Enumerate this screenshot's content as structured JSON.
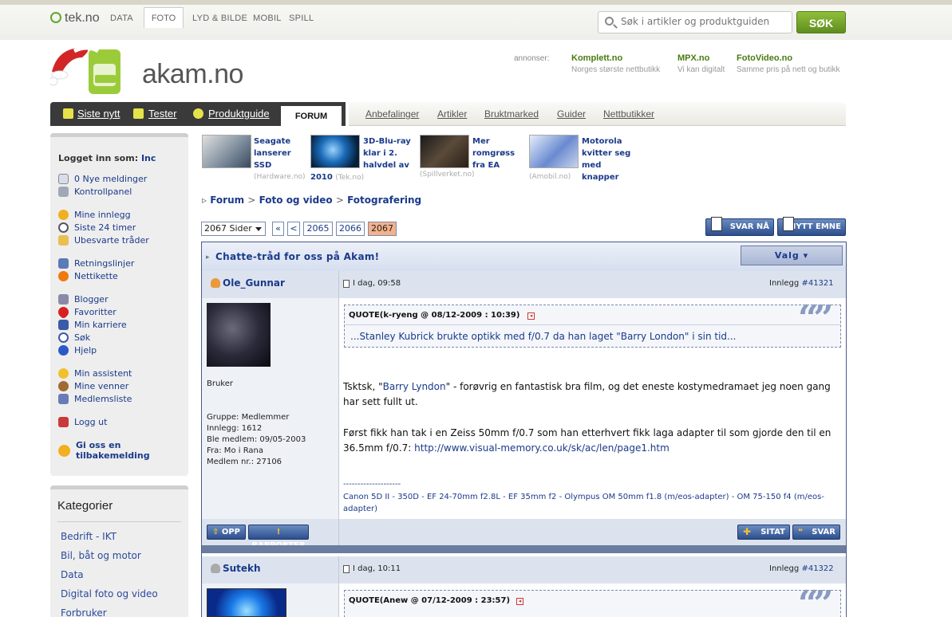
{
  "top": {
    "brand": "tek.no",
    "tabs": [
      "DATA",
      "FOTO",
      "LYD & BILDE",
      "MOBIL",
      "SPILL"
    ],
    "search_placeholder": "Søk i artikler og produktguiden",
    "search_button": "SØK"
  },
  "logo": {
    "text": "akam.no"
  },
  "ads": {
    "label": "annonser:",
    "items": [
      {
        "title": "Komplett.no",
        "sub": "Norges største nettbutikk"
      },
      {
        "title": "MPX.no",
        "sub": "Vi kan digitalt"
      },
      {
        "title": "FotoVideo.no",
        "sub": "Samme pris på nett og butikk"
      }
    ]
  },
  "nav": {
    "dark": [
      "Siste nytt",
      "Tester",
      "Produktguide"
    ],
    "active": "FORUM",
    "light": [
      "Anbefalinger",
      "Artikler",
      "Bruktmarked",
      "Guider",
      "Nettbutikker"
    ]
  },
  "sidebar": {
    "logged_label": "Logget inn som:",
    "user": "Inc",
    "items": [
      "0 Nye meldinger",
      "Kontrollpanel",
      "Mine innlegg",
      "Siste 24 timer",
      "Ubesvarte tråder",
      "Retningslinjer",
      "Nettikette",
      "Blogger",
      "Favoritter",
      "Min karriere",
      "Søk",
      "Hjelp",
      "Min assistent",
      "Mine venner",
      "Medlemsliste",
      "Logg ut",
      "Gi oss en tilbakemelding"
    ]
  },
  "kategorier": {
    "title": "Kategorier",
    "items": [
      "Bedrift - IKT",
      "Bil, båt og motor",
      "Data",
      "Digital foto og video",
      "Forbruker"
    ]
  },
  "news": [
    {
      "lines": [
        "Seagate",
        "lanserer SSD"
      ],
      "source": "(Hardware.no)"
    },
    {
      "lines": [
        "3D-Blu-ray",
        "klar i 2.",
        "halvdel av",
        "2010"
      ],
      "source": "(Tek.no)"
    },
    {
      "lines": [
        "Mer romgrøss",
        "fra EA"
      ],
      "source": "(Spillverket.no)"
    },
    {
      "lines": [
        "Motorola",
        "kvitter seg",
        "med knapper"
      ],
      "source": "(Amobil.no)"
    }
  ],
  "breadcrumb": [
    "Forum",
    "Foto og video",
    "Fotografering"
  ],
  "pagination": {
    "select": "2067 Sider",
    "first": "«",
    "prev": "<",
    "pages": [
      "2065",
      "2066",
      "2067"
    ]
  },
  "buttons": {
    "reply": "SVAR NÅ",
    "new_topic": "NYTT EMNE",
    "up": "OPP",
    "report": "RAPPORTER",
    "quote": "SITAT",
    "answer": "SVAR"
  },
  "thread": {
    "title": "Chatte-tråd for oss på Akam!",
    "menu": "Valg"
  },
  "posts": [
    {
      "author": "Ole_Gunnar",
      "time": "I dag, 09:58",
      "post_label": "Innlegg",
      "post_no": "#41321",
      "role": "Bruker",
      "info": [
        "Gruppe: Medlemmer",
        "Innlegg: 1612",
        "Ble medlem: 09/05-2003",
        "Fra: Mo i Rana",
        "Medlem nr.: 27106"
      ],
      "quote_head": "QUOTE(k-ryeng @ 08/12-2009 : 10:39)",
      "quote_body": "...Stanley Kubrick brukte optikk med f/0.7 da han laget \"Barry London\" i sin tid...",
      "body1_pre": "Tsktsk, \"",
      "body1_link": "Barry Lyndon",
      "body1_post": "\" - forøvrig en fantastisk bra film, og det eneste kostymedramaet jeg noen gang har sett fullt ut.",
      "body2": "Først fikk han tak i en Zeiss 50mm f/0.7 som han etterhvert fikk laga adapter til som gjorde den til en 36.5mm f/0.7:",
      "link": "http://www.visual-memory.co.uk/sk/ac/len/page1.htm",
      "sig_sep": "--------------------",
      "signature": "Canon 5D II - 350D - EF 24-70mm f2.8L - EF 35mm f2 - Olympus OM 50mm f1.8 (m/eos-adapter) - OM 75-150 f4 (m/eos-adapter)"
    },
    {
      "author": "Sutekh",
      "time": "I dag, 10:11",
      "post_label": "Innlegg",
      "post_no": "#41322",
      "quote_head": "QUOTE(Anew @ 07/12-2009 : 23:57)"
    }
  ]
}
